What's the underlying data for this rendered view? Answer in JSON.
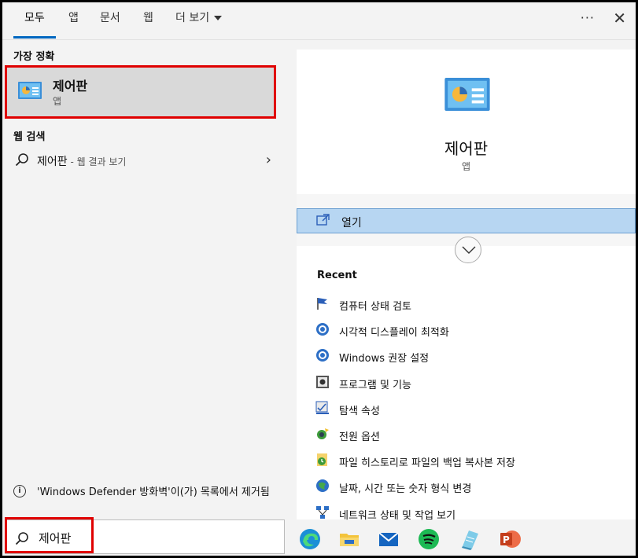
{
  "tabs": [
    {
      "label": "모두"
    },
    {
      "label": "앱"
    },
    {
      "label": "문서"
    },
    {
      "label": "웹"
    },
    {
      "label": "더 보기"
    }
  ],
  "topbar": {
    "ellipsis": "···",
    "close": "✕"
  },
  "left": {
    "best_match_label": "가장 정확",
    "best_match": {
      "title": "제어판",
      "subtitle": "앱",
      "icon": "control-panel-icon"
    },
    "web_label": "웹 검색",
    "web_result": {
      "query": "제어판",
      "hint": " - 웹 결과 보기",
      "icon": "search-icon"
    },
    "notice": {
      "icon": "info-icon",
      "text": "'Windows Defender 방화벽'이(가) 목록에서 제거됨"
    }
  },
  "search": {
    "value": "제어판",
    "icon": "search-icon"
  },
  "preview": {
    "title": "제어판",
    "subtitle": "앱",
    "open_label": "열기",
    "recent_header": "Recent",
    "recent": [
      {
        "label": "컴퓨터 상태 검토",
        "icon": "flag-icon"
      },
      {
        "label": "시각적 디스플레이 최적화",
        "icon": "accessibility-icon"
      },
      {
        "label": "Windows 권장 설정",
        "icon": "accessibility-icon"
      },
      {
        "label": "프로그램 및 기능",
        "icon": "programs-icon"
      },
      {
        "label": "탐색 속성",
        "icon": "folder-options-icon"
      },
      {
        "label": "전원 옵션",
        "icon": "power-icon"
      },
      {
        "label": "파일 히스토리로 파일의 백업 복사본 저장",
        "icon": "file-history-icon"
      },
      {
        "label": "날짜, 시간 또는 숫자 형식 변경",
        "icon": "region-icon"
      },
      {
        "label": "네트워크 상태 및 작업 보기",
        "icon": "network-icon"
      }
    ]
  },
  "taskbar": [
    {
      "icon": "edge-icon"
    },
    {
      "icon": "file-explorer-icon"
    },
    {
      "icon": "mail-icon"
    },
    {
      "icon": "spotify-icon"
    },
    {
      "icon": "notepad-icon"
    },
    {
      "icon": "powerpoint-icon"
    }
  ],
  "colors": {
    "accent": "#0067c0",
    "highlight": "#e00000",
    "open_bg": "#b7d6f2"
  }
}
